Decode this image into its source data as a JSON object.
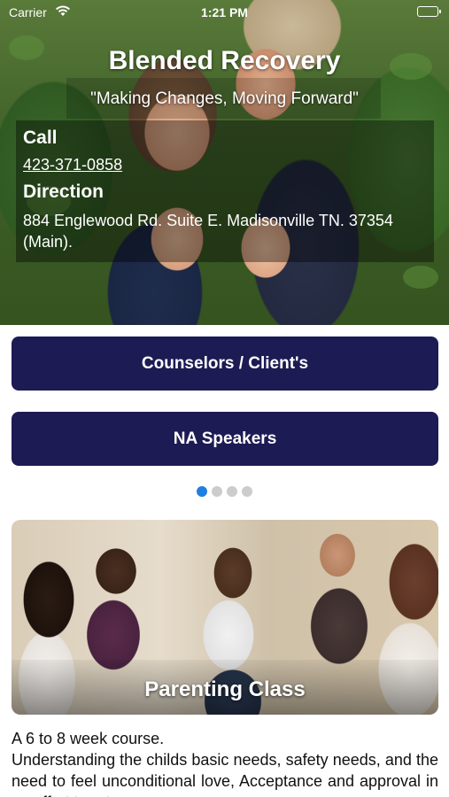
{
  "status_bar": {
    "carrier": "Carrier",
    "time": "1:21 PM"
  },
  "hero": {
    "title": "Blended Recovery",
    "tagline": "\"Making Changes, Moving Forward\"",
    "call_label": "Call",
    "phone": "423-371-0858",
    "direction_label": "Direction",
    "address": "884 Englewood Rd. Suite E. Madisonville TN. 37354 (Main)."
  },
  "buttons": {
    "counselors": "Counselors / Client's",
    "na_speakers": "NA Speakers"
  },
  "carousel": {
    "page_count": 4,
    "active_index": 0,
    "card_title": "Parenting Class"
  },
  "description": {
    "line1": "A 6 to 8 week course.",
    "line2": "Understanding the childs basic needs, safety needs, and the need to feel unconditional love, Acceptance and approval in an effort to rate"
  },
  "colors": {
    "button_bg": "#1d1b54",
    "active_dot": "#1e7fe0",
    "inactive_dot": "#cccccc"
  },
  "icons": [
    "wifi-icon",
    "battery-icon"
  ]
}
